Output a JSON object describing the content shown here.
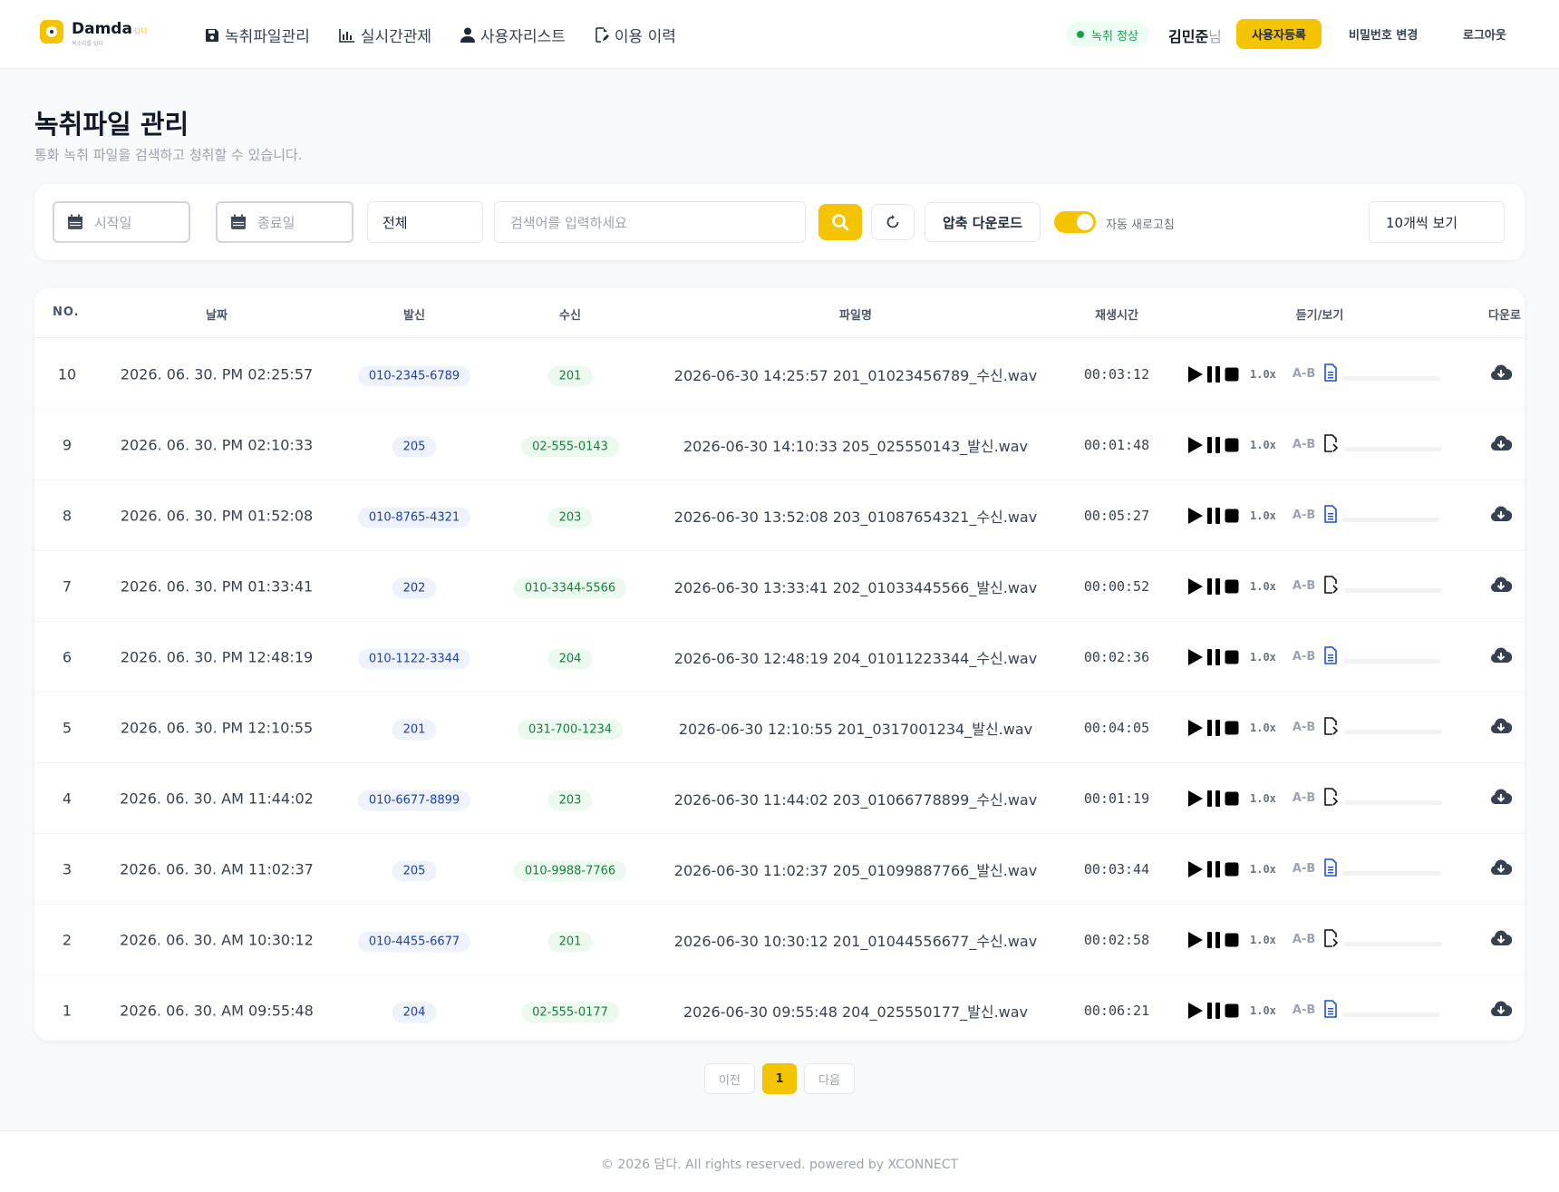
{
  "header": {
    "brand": "Damda",
    "brand_badge": "담다",
    "brand_sub": "목소리를 담다",
    "nav": [
      {
        "label": "녹취파일관리",
        "icon": "save-icon"
      },
      {
        "label": "실시간관제",
        "icon": "bar-chart-icon"
      },
      {
        "label": "사용자리스트",
        "icon": "user-icon"
      },
      {
        "label": "이용 이력",
        "icon": "edit-file-icon"
      }
    ],
    "status": "녹취 정상",
    "user_name": "김민준",
    "user_suffix": "님",
    "register_label": "사용자등록",
    "password_label": "비밀번호 변경",
    "logout_label": "로그아웃"
  },
  "page": {
    "title": "녹취파일 관리",
    "subtitle": "통화 녹취 파일을 검색하고 청취할 수 있습니다."
  },
  "filters": {
    "start_placeholder": "시작일",
    "end_placeholder": "종료일",
    "type_value": "전체",
    "search_placeholder": "검색어를 입력하세요",
    "zip_label": "압축 다운로드",
    "auto_refresh_label": "자동 새로고침",
    "auto_refresh_on": true,
    "page_size_label": "10개씩 보기"
  },
  "table": {
    "headers": {
      "no": "NO.",
      "date": "날짜",
      "caller": "발신",
      "callee": "수신",
      "filename": "파일명",
      "duration": "재생시간",
      "listen": "듣기/보기",
      "download": "다운로"
    },
    "speed_label": "1.0x",
    "ab_label": "A-B",
    "rows": [
      {
        "no": "10",
        "date": "2026. 06. 30. PM 02:25:57",
        "caller": "010-2345-6789",
        "callee": "201",
        "filename": "2026-06-30 14:25:57 201_01023456789_수신.wav",
        "duration": "00:03:12",
        "has_text": true
      },
      {
        "no": "9",
        "date": "2026. 06. 30. PM 02:10:33",
        "caller": "205",
        "callee": "02-555-0143",
        "filename": "2026-06-30 14:10:33 205_025550143_발신.wav",
        "duration": "00:01:48",
        "has_text": false
      },
      {
        "no": "8",
        "date": "2026. 06. 30. PM 01:52:08",
        "caller": "010-8765-4321",
        "callee": "203",
        "filename": "2026-06-30 13:52:08 203_01087654321_수신.wav",
        "duration": "00:05:27",
        "has_text": true
      },
      {
        "no": "7",
        "date": "2026. 06. 30. PM 01:33:41",
        "caller": "202",
        "callee": "010-3344-5566",
        "filename": "2026-06-30 13:33:41 202_01033445566_발신.wav",
        "duration": "00:00:52",
        "has_text": false
      },
      {
        "no": "6",
        "date": "2026. 06. 30. PM 12:48:19",
        "caller": "010-1122-3344",
        "callee": "204",
        "filename": "2026-06-30 12:48:19 204_01011223344_수신.wav",
        "duration": "00:02:36",
        "has_text": true
      },
      {
        "no": "5",
        "date": "2026. 06. 30. PM 12:10:55",
        "caller": "201",
        "callee": "031-700-1234",
        "filename": "2026-06-30 12:10:55 201_0317001234_발신.wav",
        "duration": "00:04:05",
        "has_text": false
      },
      {
        "no": "4",
        "date": "2026. 06. 30. AM 11:44:02",
        "caller": "010-6677-8899",
        "callee": "203",
        "filename": "2026-06-30 11:44:02 203_01066778899_수신.wav",
        "duration": "00:01:19",
        "has_text": false
      },
      {
        "no": "3",
        "date": "2026. 06. 30. AM 11:02:37",
        "caller": "205",
        "callee": "010-9988-7766",
        "filename": "2026-06-30 11:02:37 205_01099887766_발신.wav",
        "duration": "00:03:44",
        "has_text": true
      },
      {
        "no": "2",
        "date": "2026. 06. 30. AM 10:30:12",
        "caller": "010-4455-6677",
        "callee": "201",
        "filename": "2026-06-30 10:30:12 201_01044556677_수신.wav",
        "duration": "00:02:58",
        "has_text": false
      },
      {
        "no": "1",
        "date": "2026. 06. 30. AM 09:55:48",
        "caller": "204",
        "callee": "02-555-0177",
        "filename": "2026-06-30 09:55:48 204_025550177_발신.wav",
        "duration": "00:06:21",
        "has_text": true
      }
    ]
  },
  "pagination": {
    "prev": "이전",
    "current": "1",
    "next": "다음"
  },
  "footer": {
    "text": "© 2026 담다. All rights reserved. powered by XCONNECT"
  },
  "colors": {
    "accent": "#f5c400",
    "status_green": "#16a34a",
    "chip_blue": "#1e40af",
    "chip_green": "#15803d",
    "doc_active": "#1d4ed8"
  }
}
